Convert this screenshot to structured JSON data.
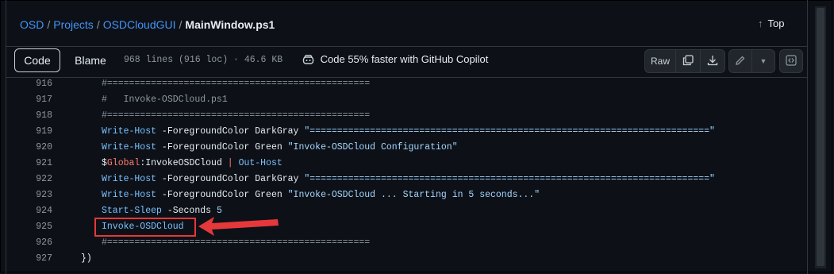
{
  "breadcrumb": {
    "items": [
      "OSD",
      "Projects",
      "OSDCloudGUI"
    ],
    "separator": "/",
    "current": "MainWindow.ps1"
  },
  "top_link": "Top",
  "toolbar": {
    "code_label": "Code",
    "blame_label": "Blame",
    "file_info": "968 lines (916 loc) · 46.6 KB",
    "copilot_text": "Code 55% faster with GitHub Copilot",
    "raw_label": "Raw"
  },
  "icons": {
    "top": "arrow-up-icon",
    "copilot": "copilot-icon",
    "copy": "copy-icon",
    "download": "download-icon",
    "edit": "pencil-icon",
    "more": "triangle-down-icon",
    "symbols": "code-square-icon"
  },
  "code_lines": [
    {
      "num": "916",
      "tokens": [
        {
          "t": "#================================================",
          "c": "cmt"
        }
      ]
    },
    {
      "num": "917",
      "tokens": [
        {
          "t": "#   Invoke-OSDCloud.ps1",
          "c": "cmt"
        }
      ]
    },
    {
      "num": "918",
      "tokens": [
        {
          "t": "#================================================",
          "c": "cmt"
        }
      ]
    },
    {
      "num": "919",
      "tokens": [
        {
          "t": "Write-Host",
          "c": "cmd"
        },
        {
          "t": " -ForegroundColor DarkGray ",
          "c": "plain"
        },
        {
          "t": "\"=========================================================================\"",
          "c": "str"
        }
      ]
    },
    {
      "num": "920",
      "tokens": [
        {
          "t": "Write-Host",
          "c": "cmd"
        },
        {
          "t": " -ForegroundColor Green ",
          "c": "plain"
        },
        {
          "t": "\"Invoke-OSDCloud Configuration\"",
          "c": "str"
        }
      ]
    },
    {
      "num": "921",
      "tokens": [
        {
          "t": "$",
          "c": "plain"
        },
        {
          "t": "Global",
          "c": "kw"
        },
        {
          "t": ":InvokeOSDCloud ",
          "c": "plain"
        },
        {
          "t": "|",
          "c": "kw"
        },
        {
          "t": " ",
          "c": "plain"
        },
        {
          "t": "Out-Host",
          "c": "cmd"
        }
      ]
    },
    {
      "num": "922",
      "tokens": [
        {
          "t": "Write-Host",
          "c": "cmd"
        },
        {
          "t": " -ForegroundColor DarkGray ",
          "c": "plain"
        },
        {
          "t": "\"=========================================================================\"",
          "c": "str"
        }
      ]
    },
    {
      "num": "923",
      "tokens": [
        {
          "t": "Write-Host",
          "c": "cmd"
        },
        {
          "t": " -ForegroundColor Green ",
          "c": "plain"
        },
        {
          "t": "\"Invoke-OSDCloud ... Starting in 5 seconds...\"",
          "c": "str"
        }
      ]
    },
    {
      "num": "924",
      "tokens": [
        {
          "t": "Start-Sleep",
          "c": "cmd"
        },
        {
          "t": " -Seconds ",
          "c": "plain"
        },
        {
          "t": "5",
          "c": "str"
        }
      ]
    },
    {
      "num": "925",
      "tokens": [
        {
          "t": "Invoke-OSDCloud",
          "c": "cmd"
        }
      ]
    },
    {
      "num": "926",
      "tokens": [
        {
          "t": "#================================================",
          "c": "cmt"
        }
      ]
    },
    {
      "num": "927",
      "tokens": [
        {
          "t": "})",
          "c": "plain"
        }
      ]
    }
  ],
  "code_indent": [
    1,
    1,
    1,
    1,
    1,
    1,
    1,
    1,
    1,
    1,
    1,
    0
  ],
  "colors": {
    "background": "#0d1117",
    "link": "#4493f8",
    "highlight": "#e5383b"
  }
}
